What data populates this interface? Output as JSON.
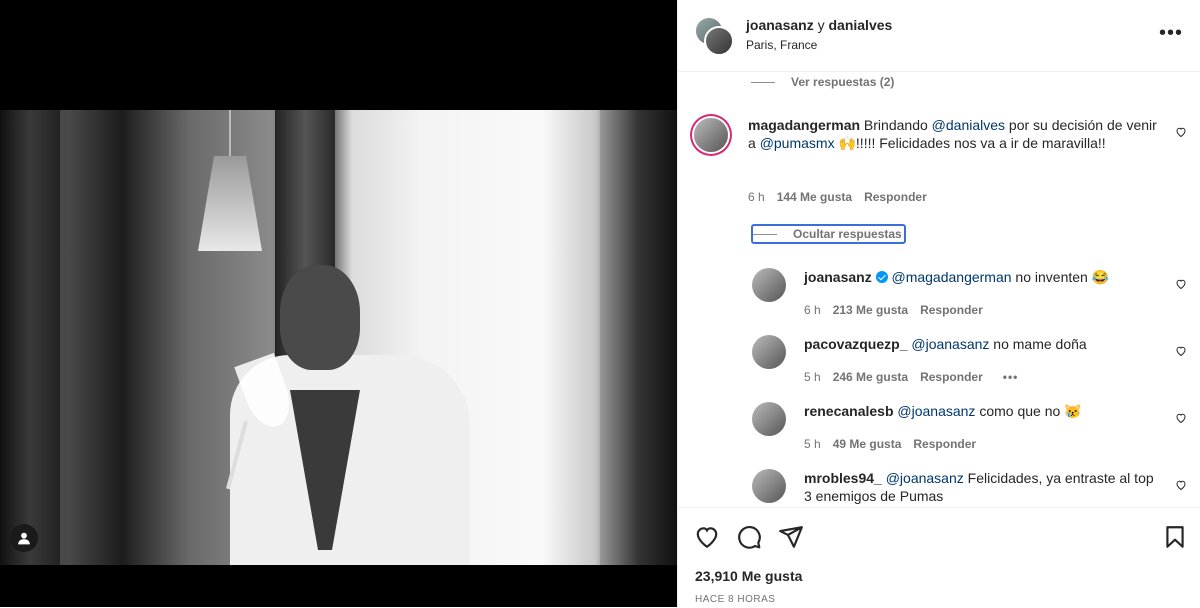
{
  "post": {
    "author_primary": "joanasanz",
    "connector": " y ",
    "author_secondary": "danialves",
    "location": "Paris, France",
    "more": "•••",
    "likes": "23,910 Me gusta",
    "posted": "HACE 8 HORAS"
  },
  "comments": {
    "view_replies_top": "Ver respuestas (2)",
    "hide_replies": "Ocultar respuestas",
    "main": {
      "user": "magadangerman",
      "text_1": " Brindando ",
      "mention_1": "@danialves",
      "text_2": " por su decisión de venir a ",
      "mention_2": "@pumasmx",
      "text_3": " 🙌!!!!! Felicidades nos va a ir de maravilla!!",
      "time": "6 h",
      "likes": "144 Me gusta",
      "reply": "Responder"
    },
    "replies": [
      {
        "user": "joanasanz",
        "verified": true,
        "mention": "@magadangerman",
        "text": " no inventen 😂",
        "time": "6 h",
        "likes": "213 Me gusta",
        "reply": "Responder",
        "more": ""
      },
      {
        "user": "pacovazquezp_",
        "verified": false,
        "mention": "@joanasanz",
        "text": " no mame doña",
        "time": "5 h",
        "likes": "246 Me gusta",
        "reply": "Responder",
        "more": "•••"
      },
      {
        "user": "renecanalesb",
        "verified": false,
        "mention": "@joanasanz",
        "text": " como que no 😿",
        "time": "5 h",
        "likes": "49 Me gusta",
        "reply": "Responder",
        "more": ""
      },
      {
        "user": "mrobles94_",
        "verified": false,
        "mention": "@joanasanz",
        "text": " Felicidades, ya entraste al top 3 enemigos de Pumas",
        "time": "",
        "likes": "",
        "reply": "",
        "more": ""
      }
    ]
  },
  "icons": {
    "like": "heart-icon",
    "comment": "comment-icon",
    "share": "paper-plane-icon",
    "save": "bookmark-icon",
    "tagged": "user-icon"
  }
}
